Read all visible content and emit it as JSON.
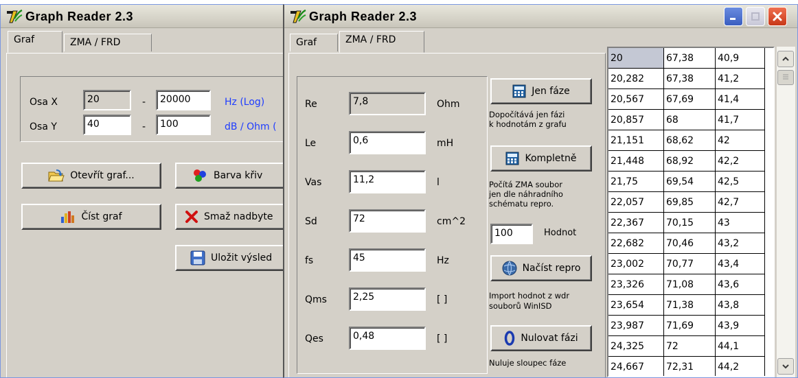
{
  "app_title": "Graph Reader 2.3",
  "left_window": {
    "tabs": [
      "Graf",
      "ZMA / FRD"
    ],
    "axis_x": {
      "label": "Osa X",
      "from": "20",
      "dash": "-",
      "to": "20000",
      "unit": "Hz (Log)"
    },
    "axis_y": {
      "label": "Osa Y",
      "from": "40",
      "dash": "-",
      "to": "100",
      "unit": "dB / Ohm ("
    },
    "buttons": {
      "open_graph": "Otevřít graf...",
      "read_graph": "Číst graf",
      "curve_color": "Barva křiv",
      "delete_extra": "Smaž nadbyte",
      "save_result": "Uložit výsled"
    }
  },
  "right_window": {
    "tabs": [
      "Graf",
      "ZMA / FRD"
    ],
    "params": [
      {
        "name": "Re",
        "value": "7,8",
        "unit": "Ohm"
      },
      {
        "name": "Le",
        "value": "0,6",
        "unit": "mH"
      },
      {
        "name": "Vas",
        "value": "11,2",
        "unit": "l"
      },
      {
        "name": "Sd",
        "value": "72",
        "unit": "cm^2"
      },
      {
        "name": "fs",
        "value": "45",
        "unit": "Hz"
      },
      {
        "name": "Qms",
        "value": "2,25",
        "unit": "[ ]"
      },
      {
        "name": "Qes",
        "value": "0,48",
        "unit": "[ ]"
      }
    ],
    "phase_only": {
      "label": "Jen fáze",
      "note1": "Dopočítává jen fázi",
      "note2": "k hodnotám  z grafu"
    },
    "complete": {
      "label": "Kompletně",
      "note1": "Počítá ZMA soubor",
      "note2": "jen dle náhradního",
      "note3": "schématu repro."
    },
    "count": {
      "value": "100",
      "label": "Hodnot"
    },
    "load": {
      "label": "Načíst repro",
      "note1": "Import hodnot z wdr",
      "note2": "souborů WinISD"
    },
    "reset": {
      "label": "Nulovat fázi",
      "note1": "Nuluje sloupec fáze"
    },
    "table": [
      [
        "20",
        "67,38",
        "40,9"
      ],
      [
        "20,282",
        "67,38",
        "41,2"
      ],
      [
        "20,567",
        "67,69",
        "41,4"
      ],
      [
        "20,857",
        "68",
        "41,7"
      ],
      [
        "21,151",
        "68,62",
        "42"
      ],
      [
        "21,448",
        "68,92",
        "42,2"
      ],
      [
        "21,75",
        "69,54",
        "42,5"
      ],
      [
        "22,057",
        "69,85",
        "42,7"
      ],
      [
        "22,367",
        "70,15",
        "43"
      ],
      [
        "22,682",
        "70,46",
        "43,2"
      ],
      [
        "23,002",
        "70,77",
        "43,4"
      ],
      [
        "23,326",
        "71,08",
        "43,6"
      ],
      [
        "23,654",
        "71,38",
        "43,8"
      ],
      [
        "23,987",
        "71,69",
        "43,9"
      ],
      [
        "24,325",
        "72",
        "44,1"
      ],
      [
        "24,667",
        "72,31",
        "44,2"
      ]
    ]
  }
}
